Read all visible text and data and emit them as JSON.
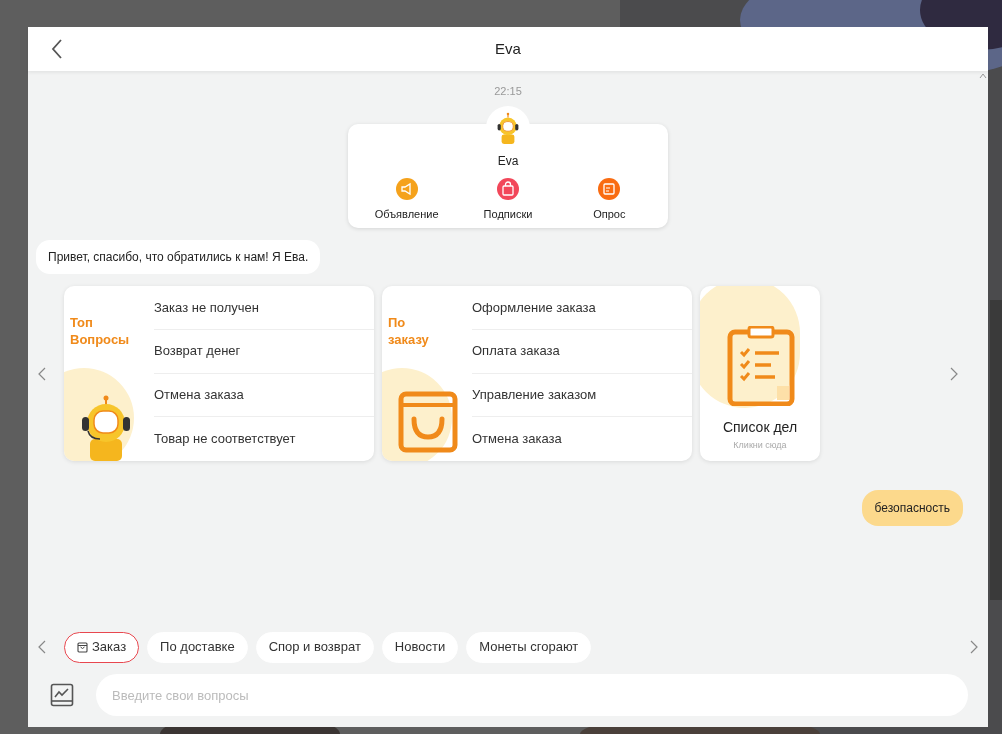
{
  "header": {
    "title": "Eva"
  },
  "chat": {
    "timestamp": "22:15",
    "bot_card": {
      "name": "Eva",
      "actions": [
        {
          "label": "Объявление",
          "kind": "megaphone",
          "color": "#f5a21c"
        },
        {
          "label": "Подписки",
          "kind": "bag",
          "color": "#f2475a"
        },
        {
          "label": "Опрос",
          "kind": "form",
          "color": "#f96c12"
        }
      ]
    },
    "greeting": "Привет, спасибо, что обратились к нам! Я Ева.",
    "cards": [
      {
        "kind": "robot_list",
        "title": "Топ Вопросы",
        "items": [
          "Заказ не получен",
          "Возврат денег",
          "Отмена заказа",
          "Товар не соответствует"
        ]
      },
      {
        "kind": "bag_list",
        "title": "По заказу",
        "items": [
          "Оформление заказа",
          "Оплата заказа",
          "Управление заказом",
          "Отмена заказа"
        ]
      },
      {
        "kind": "tile",
        "title": "Список дел",
        "subtitle": "Кликни сюда"
      }
    ],
    "user_message": "безопасность"
  },
  "quick_replies": [
    {
      "label": "Заказ",
      "selected": true,
      "icon": true
    },
    {
      "label": "По доставке",
      "selected": false
    },
    {
      "label": "Спор и возврат",
      "selected": false
    },
    {
      "label": "Новости",
      "selected": false
    },
    {
      "label": "Монеты сгорают",
      "selected": false
    }
  ],
  "input": {
    "placeholder": "Введите свои вопросы"
  }
}
